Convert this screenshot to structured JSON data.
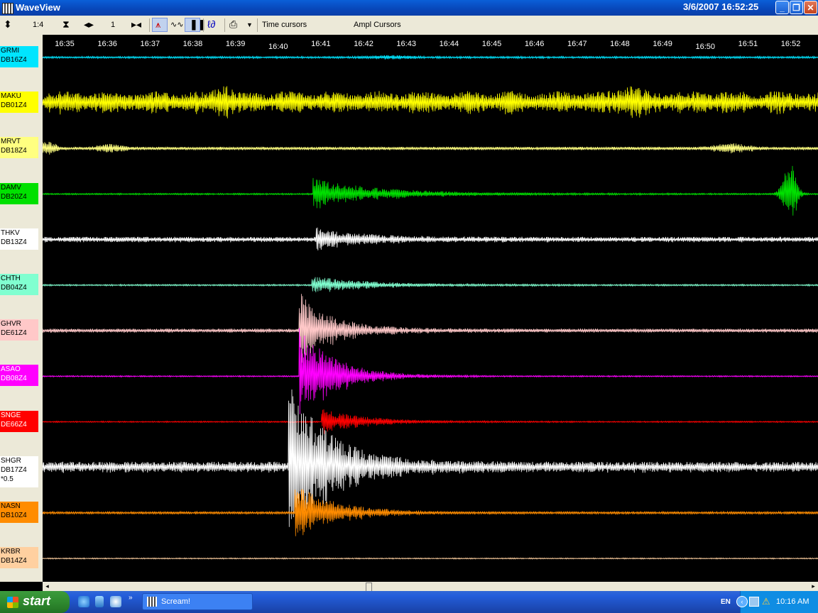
{
  "window": {
    "title": "WaveView",
    "datetime": "3/6/2007 16:52:25",
    "minimize": "_",
    "maximize": "❐",
    "close": "✕"
  },
  "toolbar": {
    "zoom_ratio": "1:4",
    "step": "1",
    "time_cursors": "Time cursors",
    "ampl_cursors": "Ampl Cursors"
  },
  "time_axis": [
    "16:35",
    "16:36",
    "16:37",
    "16:38",
    "16:39",
    "16:40",
    "16:41",
    "16:42",
    "16:43",
    "16:44",
    "16:45",
    "16:46",
    "16:47",
    "16:48",
    "16:49",
    "16:50",
    "16:51",
    "16:52"
  ],
  "traces": [
    {
      "station": "GRMI",
      "channel": "DB16Z4",
      "color": "#00e5ff",
      "gain": ""
    },
    {
      "station": "MAKU",
      "channel": "DB01Z4",
      "color": "#ffff00",
      "gain": ""
    },
    {
      "station": "MRVT",
      "channel": "DB18Z4",
      "color": "#ffff80",
      "gain": ""
    },
    {
      "station": "DAMV",
      "channel": "DB20Z4",
      "color": "#00e000",
      "gain": ""
    },
    {
      "station": "THKV",
      "channel": "DB13Z4",
      "color": "#ffffff",
      "gain": ""
    },
    {
      "station": "CHTH",
      "channel": "DB04Z4",
      "color": "#80ffd0",
      "gain": ""
    },
    {
      "station": "GHVR",
      "channel": "DE61Z4",
      "color": "#ffc8c8",
      "gain": ""
    },
    {
      "station": "ASAO",
      "channel": "DB08Z4",
      "color": "#ff00ff",
      "gain": ""
    },
    {
      "station": "SNGE",
      "channel": "DE66Z4",
      "color": "#ff0000",
      "gain": ""
    },
    {
      "station": "SHGR",
      "channel": "DB17Z4",
      "color": "#ffffff",
      "gain": "*0.5"
    },
    {
      "station": "NASN",
      "channel": "DB10Z4",
      "color": "#ff8c00",
      "gain": ""
    },
    {
      "station": "KRBR",
      "channel": "DB14Z4",
      "color": "#ffd0a0",
      "gain": ""
    }
  ],
  "taskbar": {
    "start": "start",
    "task_item": "Scream!",
    "language": "EN",
    "clock": "10:16 AM"
  }
}
